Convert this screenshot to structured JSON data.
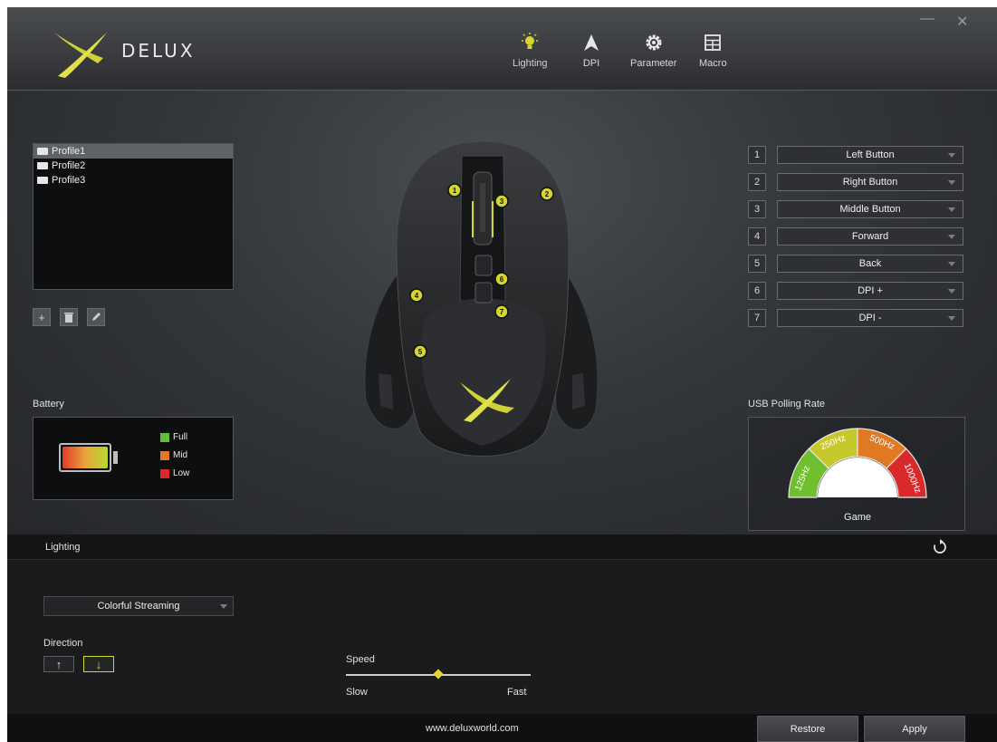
{
  "brand": {
    "name": "DELUX",
    "accent": "#d4d531"
  },
  "window": {
    "minimize": "—",
    "close": "✕"
  },
  "nav": [
    {
      "label": "Lighting",
      "icon": "bulb-icon",
      "active": true
    },
    {
      "label": "DPI",
      "icon": "arrow-icon"
    },
    {
      "label": "Parameter",
      "icon": "gear-icon"
    },
    {
      "label": "Macro",
      "icon": "grid-icon"
    }
  ],
  "profiles": {
    "items": [
      "Profile1",
      "Profile2",
      "Profile3"
    ],
    "selected": "Profile1"
  },
  "battery": {
    "title": "Battery",
    "legend": [
      {
        "label": "Full",
        "color": "#5fbf3a"
      },
      {
        "label": "Mid",
        "color": "#e07a2a"
      },
      {
        "label": "Low",
        "color": "#d82a2a"
      }
    ]
  },
  "mouse": {
    "button_markers": [
      "1",
      "2",
      "3",
      "4",
      "5",
      "6",
      "7"
    ]
  },
  "mapping": [
    {
      "num": "1",
      "value": "Left Button"
    },
    {
      "num": "2",
      "value": "Right Button"
    },
    {
      "num": "3",
      "value": "Middle Button"
    },
    {
      "num": "4",
      "value": "Forward"
    },
    {
      "num": "5",
      "value": "Back"
    },
    {
      "num": "6",
      "value": "DPI +"
    },
    {
      "num": "7",
      "value": "DPI -"
    }
  ],
  "usb": {
    "title": "USB Polling Rate",
    "rates": [
      "125Hz",
      "250Hz",
      "500Hz",
      "1000Hz"
    ],
    "colors": [
      "#6fbf2e",
      "#c8c82a",
      "#e07a22",
      "#d82a2a"
    ],
    "mode": "Game"
  },
  "lighting": {
    "bar_title": "Lighting",
    "effect": "Colorful Streaming",
    "direction_title": "Direction",
    "direction_up": "↑",
    "direction_down": "↓",
    "direction_selected": "down",
    "speed_title": "Speed",
    "speed_slow": "Slow",
    "speed_fast": "Fast",
    "speed_value": 0.5
  },
  "footer": {
    "website": "www.deluxworld.com",
    "restore": "Restore",
    "apply": "Apply"
  }
}
